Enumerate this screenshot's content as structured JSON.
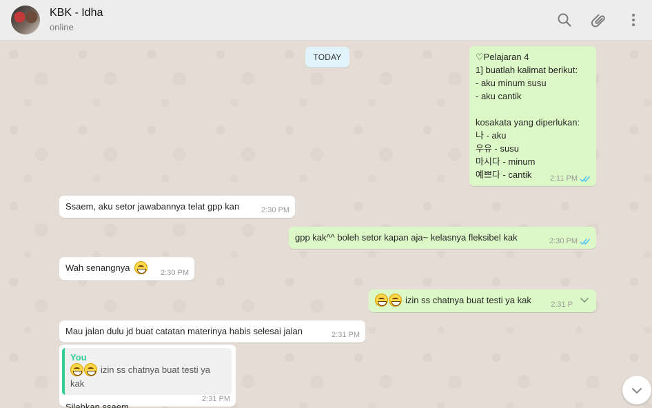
{
  "header": {
    "contact_name": "KBK - Idha",
    "status": "online",
    "icons": [
      "search-icon",
      "attach-icon",
      "menu-icon"
    ]
  },
  "chat": {
    "date_chip": "TODAY",
    "messages": [
      {
        "direction": "out",
        "text": "♡Pelajaran 4\n1] buatlah kalimat berikut:\n- aku minum susu\n- aku cantik\n\nkosakata yang diperlukan:\n나 - aku\n우유 - susu\n마시다 - minum\n예쁘다 - cantik",
        "time": "2:11 PM",
        "read": true
      },
      {
        "direction": "in",
        "text": "Ssaem, aku setor jawabannya telat gpp kan",
        "time": "2:30 PM"
      },
      {
        "direction": "out",
        "text": "gpp kak^^ boleh setor kapan aja~ kelasnya fleksibel kak",
        "time": "2:30 PM",
        "read": true
      },
      {
        "direction": "in",
        "text": "Wah senangnya",
        "emoji": "grinning-face",
        "time": "2:30 PM"
      },
      {
        "direction": "out",
        "emoji_prefix": "grinning-face x2",
        "text": "izin ss chatnya buat testi ya kak",
        "time": "2:31 P"
      },
      {
        "direction": "in",
        "text": "Mau jalan dulu jd buat catatan materinya habis selesai jalan",
        "time": "2:31 PM"
      },
      {
        "direction": "in",
        "quote": {
          "author": "You",
          "text": "izin ss chatnya buat testi ya kak"
        },
        "text": "Silahkan ssaem",
        "time": "2:31 PM"
      }
    ]
  },
  "colors": {
    "outgoing_bubble": "#dcf8c6",
    "incoming_bubble": "#ffffff",
    "read_ticks": "#4fc3f7",
    "quote_accent": "#35cd96",
    "chat_background": "#e5ddd5"
  }
}
